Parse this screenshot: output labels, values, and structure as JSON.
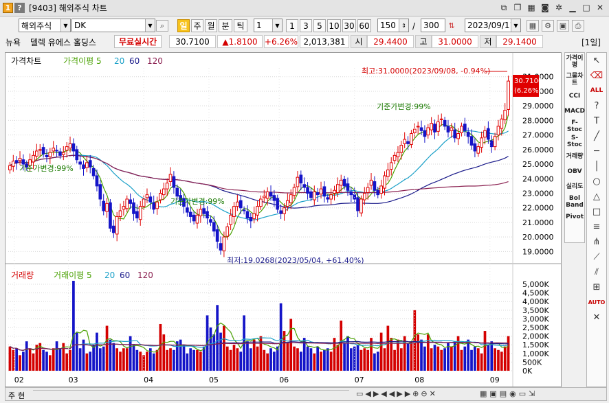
{
  "window": {
    "code": "1",
    "help": "?",
    "title": "[9403] 해외주식 차트"
  },
  "toolbar": {
    "market": "해외주식",
    "symbol": "DK",
    "periods": [
      "일",
      "주",
      "월",
      "분",
      "틱"
    ],
    "active_period": "일",
    "interval": "1",
    "steps": [
      "1",
      "3",
      "5",
      "10",
      "30",
      "60"
    ],
    "count": "150",
    "total": "300",
    "date": "2023/09/11"
  },
  "quote": {
    "exchange": "뉴욕",
    "name": "델렉 유에스 홀딩스",
    "live": "무료실시간",
    "price": "30.7100",
    "change": "▲1.8100",
    "pct": "+6.26%",
    "volume": "2,013,381",
    "open_lbl": "시",
    "open": "29.4400",
    "high_lbl": "고",
    "high": "31.0000",
    "low_lbl": "저",
    "low": "29.1400",
    "period_btn": "[1일]"
  },
  "price_panel": {
    "legend": [
      "가격차트",
      "가격이평 5",
      "20",
      "60",
      "120"
    ],
    "current_tag": "30.7100",
    "current_pct": "(6.26%)",
    "max_note": "최고:31.0000(2023/09/08, -0.94%)",
    "min_note": "최저:19.0268(2023/05/04, +61.40%)",
    "base_notes": [
      "기준가변경:99%",
      "기준가변경:99%",
      "기준가변경:99%"
    ]
  },
  "volume_panel": {
    "legend": [
      "거래량",
      "거래이평 5",
      "20",
      "60",
      "120"
    ]
  },
  "side_indicators": [
    "가격이평",
    "그물차트",
    "CCI",
    "MACD",
    "F-Stoc",
    "S-Stoc",
    "거래량",
    "OBV",
    "실리도",
    "Bol Band",
    "Pivot"
  ],
  "right_tools": [
    "cursor-icon",
    "eraser-icon",
    "all-icon",
    "question-icon",
    "text-icon",
    "line-icon",
    "hline-icon",
    "vline-icon",
    "circle-icon",
    "triangle-icon",
    "rect-icon",
    "fib-icon",
    "gann-icon",
    "fan-icon",
    "channel-icon",
    "grid-icon",
    "auto-icon",
    "delete-icon"
  ],
  "status": {
    "left": "주",
    "left2": "현"
  },
  "chart_data": {
    "type": "candlestick",
    "x_labels": [
      "02",
      "03",
      "04",
      "05",
      "06",
      "07",
      "08",
      "09"
    ],
    "price_ticks": [
      "31.0000",
      "30.0000",
      "29.0000",
      "28.0000",
      "27.0000",
      "26.0000",
      "25.0000",
      "24.0000",
      "23.0000",
      "22.0000",
      "21.0000",
      "20.0000",
      "19.0000"
    ],
    "price_range": [
      18.5,
      31.6
    ],
    "volume_ticks": [
      "5,000K",
      "4,500K",
      "4,000K",
      "3,500K",
      "3,000K",
      "2,500K",
      "2,000K",
      "1,500K",
      "1,000K",
      "500K",
      "0K"
    ],
    "volume_range": [
      0,
      5200
    ],
    "max_point": {
      "value": 31.0,
      "date": "2023/09/08"
    },
    "min_point": {
      "value": 19.0268,
      "date": "2023/05/04"
    },
    "close_series": [
      24.9,
      25.2,
      25.1,
      25.4,
      25.0,
      24.8,
      25.3,
      25.6,
      25.9,
      26.0,
      25.7,
      25.5,
      25.8,
      26.1,
      25.9,
      25.6,
      25.8,
      26.2,
      26.4,
      25.9,
      25.3,
      25.0,
      24.7,
      25.1,
      24.8,
      24.2,
      23.5,
      22.6,
      21.8,
      22.3,
      20.6,
      20.3,
      21.4,
      21.8,
      22.1,
      22.6,
      22.3,
      21.6,
      21.3,
      22.1,
      22.6,
      22.9,
      22.4,
      21.9,
      22.4,
      23.0,
      23.3,
      23.7,
      24.3,
      23.4,
      22.8,
      22.5,
      22.1,
      21.7,
      21.4,
      21.1,
      21.5,
      21.9,
      21.6,
      21.3,
      21.0,
      20.4,
      19.7,
      19.1,
      20.0,
      20.7,
      21.5,
      22.1,
      22.4,
      22.0,
      21.8,
      21.3,
      21.1,
      21.6,
      22.1,
      22.6,
      22.8,
      23.1,
      22.8,
      22.5,
      21.9,
      21.6,
      22.0,
      22.5,
      22.9,
      23.4,
      24.1,
      23.7,
      23.4,
      23.0,
      22.7,
      23.1,
      22.9,
      23.3,
      22.8,
      22.6,
      22.9,
      23.2,
      23.6,
      23.9,
      23.5,
      23.2,
      22.9,
      22.6,
      21.8,
      22.6,
      23.0,
      23.4,
      23.9,
      23.2,
      22.9,
      23.5,
      24.2,
      24.6,
      25.1,
      25.6,
      25.8,
      26.3,
      26.7,
      26.4,
      27.1,
      27.4,
      27.6,
      27.3,
      26.9,
      27.5,
      27.8,
      27.2,
      27.9,
      28.1,
      27.6,
      27.2,
      27.5,
      26.8,
      27.1,
      27.6,
      27.3,
      26.9,
      26.3,
      25.9,
      26.2,
      26.8,
      27.3,
      26.7,
      26.2,
      26.9,
      27.6,
      28.1,
      28.7,
      30.7
    ],
    "volume_series": [
      1400,
      1200,
      1300,
      900,
      1100,
      1700,
      1300,
      1000,
      1500,
      1600,
      1200,
      1100,
      900,
      1300,
      1700,
      1300,
      1600,
      1000,
      1200,
      5200,
      2200,
      1300,
      1800,
      1000,
      1100,
      1500,
      2200,
      1300,
      1400,
      2600,
      1800,
      1600,
      1300,
      1100,
      1300,
      1300,
      2000,
      1500,
      1200,
      1100,
      900,
      1100,
      1300,
      1000,
      1200,
      2700,
      2100,
      1200,
      1300,
      1200,
      1700,
      1800,
      1500,
      1000,
      1300,
      1200,
      1200,
      1100,
      1400,
      3200,
      2500,
      2100,
      3800,
      2200,
      2600,
      1400,
      1200,
      1500,
      1300,
      1100,
      3200,
      1700,
      1300,
      1800,
      1400,
      2000,
      1200,
      1000,
      1300,
      1100,
      1400,
      3900,
      2300,
      1600,
      3000,
      1400,
      1300,
      1100,
      1900,
      1400,
      1300,
      1000,
      1400,
      1100,
      1200,
      1300,
      1100,
      1900,
      1500,
      2900,
      1600,
      2000,
      1300,
      1400,
      1500,
      1200,
      1300,
      1200,
      1900,
      1000,
      1100,
      2200,
      1300,
      2600,
      1900,
      1200,
      1800,
      1300,
      2000,
      1600,
      1700,
      3500,
      2100,
      1800,
      1400,
      2100,
      1300,
      1500,
      1400,
      1200,
      1300,
      1600,
      1400,
      1700,
      2000,
      1200,
      1400,
      1800,
      1200,
      1400,
      1300,
      1000,
      2300,
      1500,
      1700,
      1300,
      1200,
      1100,
      1400,
      2000
    ]
  }
}
